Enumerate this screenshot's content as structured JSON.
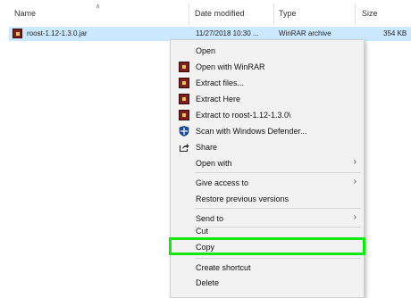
{
  "columns": {
    "name": "Name",
    "date_modified": "Date modified",
    "type": "Type",
    "size": "Size"
  },
  "file": {
    "name": "roost-1.12-1.3.0.jar",
    "date": "11/27/2018 10:30 ...",
    "type": "WinRAR archive",
    "size": "354 KB"
  },
  "menu": {
    "open": "Open",
    "open_with_winrar": "Open with WinRAR",
    "extract_files": "Extract files...",
    "extract_here": "Extract Here",
    "extract_to": "Extract to roost-1.12-1.3.0\\",
    "scan_defender": "Scan with Windows Defender...",
    "share": "Share",
    "open_with": "Open with",
    "give_access": "Give access to",
    "restore_versions": "Restore previous versions",
    "send_to": "Send to",
    "cut": "Cut",
    "copy": "Copy",
    "create_shortcut": "Create shortcut",
    "delete": "Delete"
  },
  "colors": {
    "selection": "#cce8ff",
    "highlight_border": "#14e810",
    "menu_bg": "#f2f2f2"
  }
}
